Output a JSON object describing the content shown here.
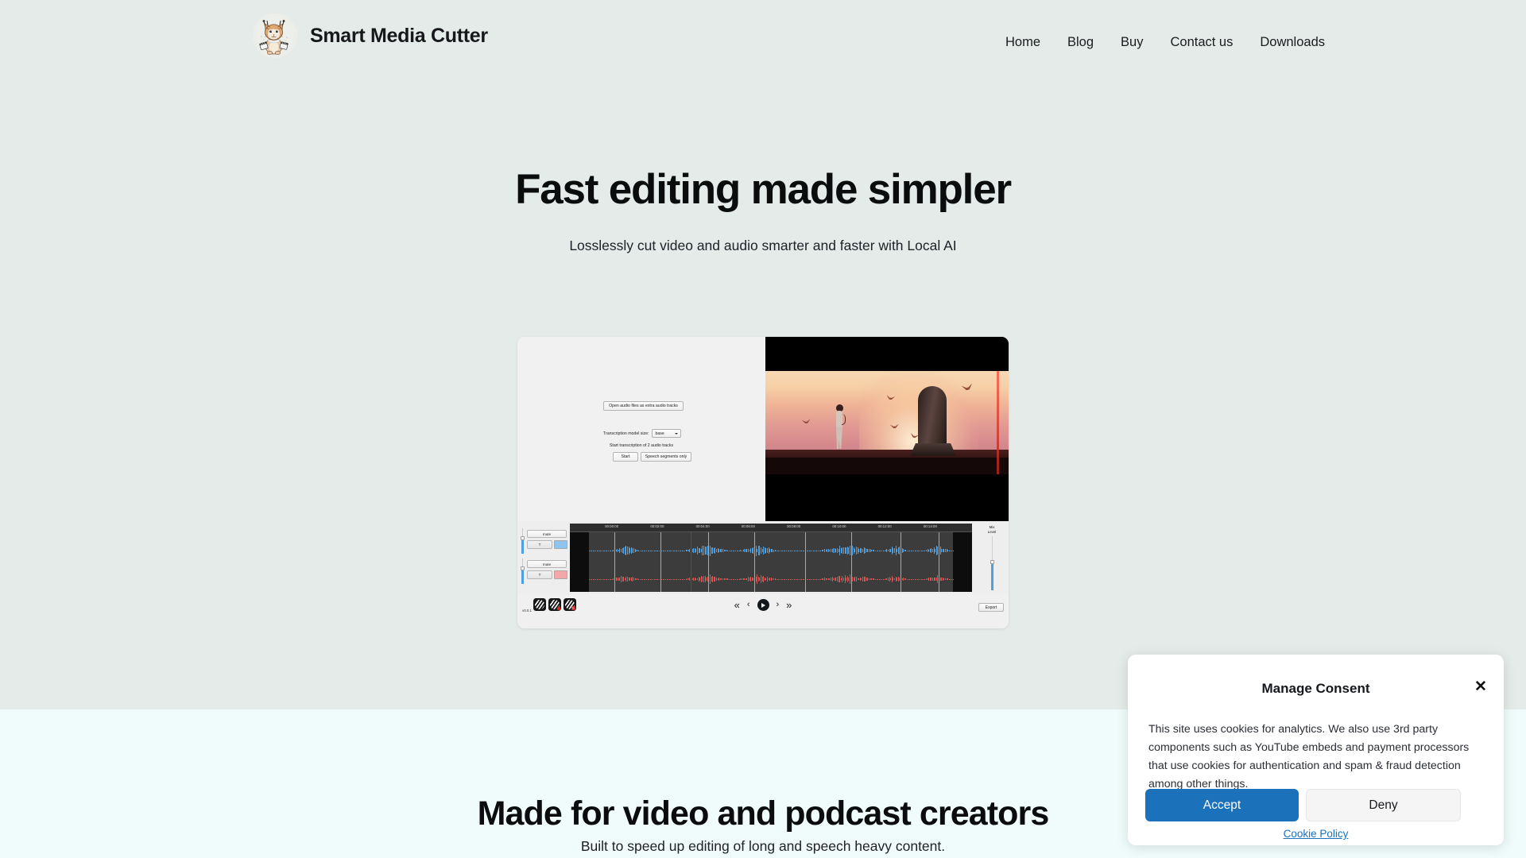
{
  "header": {
    "brand_name": "Smart Media Cutter",
    "logo_icon": "lynx-mascot-clapperboard-logo",
    "nav": [
      {
        "label": "Home"
      },
      {
        "label": "Blog"
      },
      {
        "label": "Buy"
      },
      {
        "label": "Contact us"
      },
      {
        "label": "Downloads"
      }
    ]
  },
  "hero": {
    "title": "Fast editing made simpler",
    "subtitle": "Losslessly cut video and audio smarter and faster with Local AI"
  },
  "app_screenshot": {
    "left_panel": {
      "open_audio_button": "Open audio files as extra audio tracks",
      "model_label": "Transcription model size:",
      "model_value": "base",
      "start_info": "Start transcription of 2 audio tracks",
      "start_button": "Start",
      "speech_button": "Speech segments only"
    },
    "timeline": {
      "ruler_ticks": [
        "00:00:00",
        "00:02:00",
        "00:04:00",
        "00:06:00",
        "00:08:00",
        "00:10:00",
        "00:12:00",
        "00:14:00"
      ],
      "tracks": [
        {
          "mute_label": "mute",
          "t_label": "T",
          "color": "#8ec4f0"
        },
        {
          "mute_label": "mute",
          "t_label": "T",
          "color": "#f2a8a8"
        }
      ],
      "mix_label": "Mix\nLevel",
      "mix_label_line1": "Mix",
      "mix_label_line2": "Level"
    },
    "bottom_bar": {
      "version": "v0.0.1",
      "tool_icons": [
        "cut-tool-icon",
        "cut-tool-badge-icon",
        "delete-cut-icon"
      ],
      "transport": [
        "skip-back-icon",
        "step-back-icon",
        "play-icon",
        "step-forward-icon",
        "skip-forward-icon"
      ],
      "export_button": "Export"
    }
  },
  "section2": {
    "title": "Made for video and podcast creators",
    "subtitle": "Built to speed up editing of long and speech heavy content."
  },
  "consent": {
    "title": "Manage Consent",
    "close_icon": "close-icon",
    "body": "This site uses cookies for analytics. We also use 3rd party components such as YouTube embeds and payment processors that use cookies for authentication and spam & fraud detection among other things.",
    "accept_label": "Accept",
    "deny_label": "Deny",
    "cookie_policy_label": "Cookie Policy"
  },
  "colors": {
    "hero_background": "#e5ebe8",
    "section2_background": "#effcfb",
    "accent_blue": "#1b72bb",
    "text_dark": "#0b0c0e",
    "track_blue": "#4d9fe0",
    "track_red": "#d9534f"
  }
}
